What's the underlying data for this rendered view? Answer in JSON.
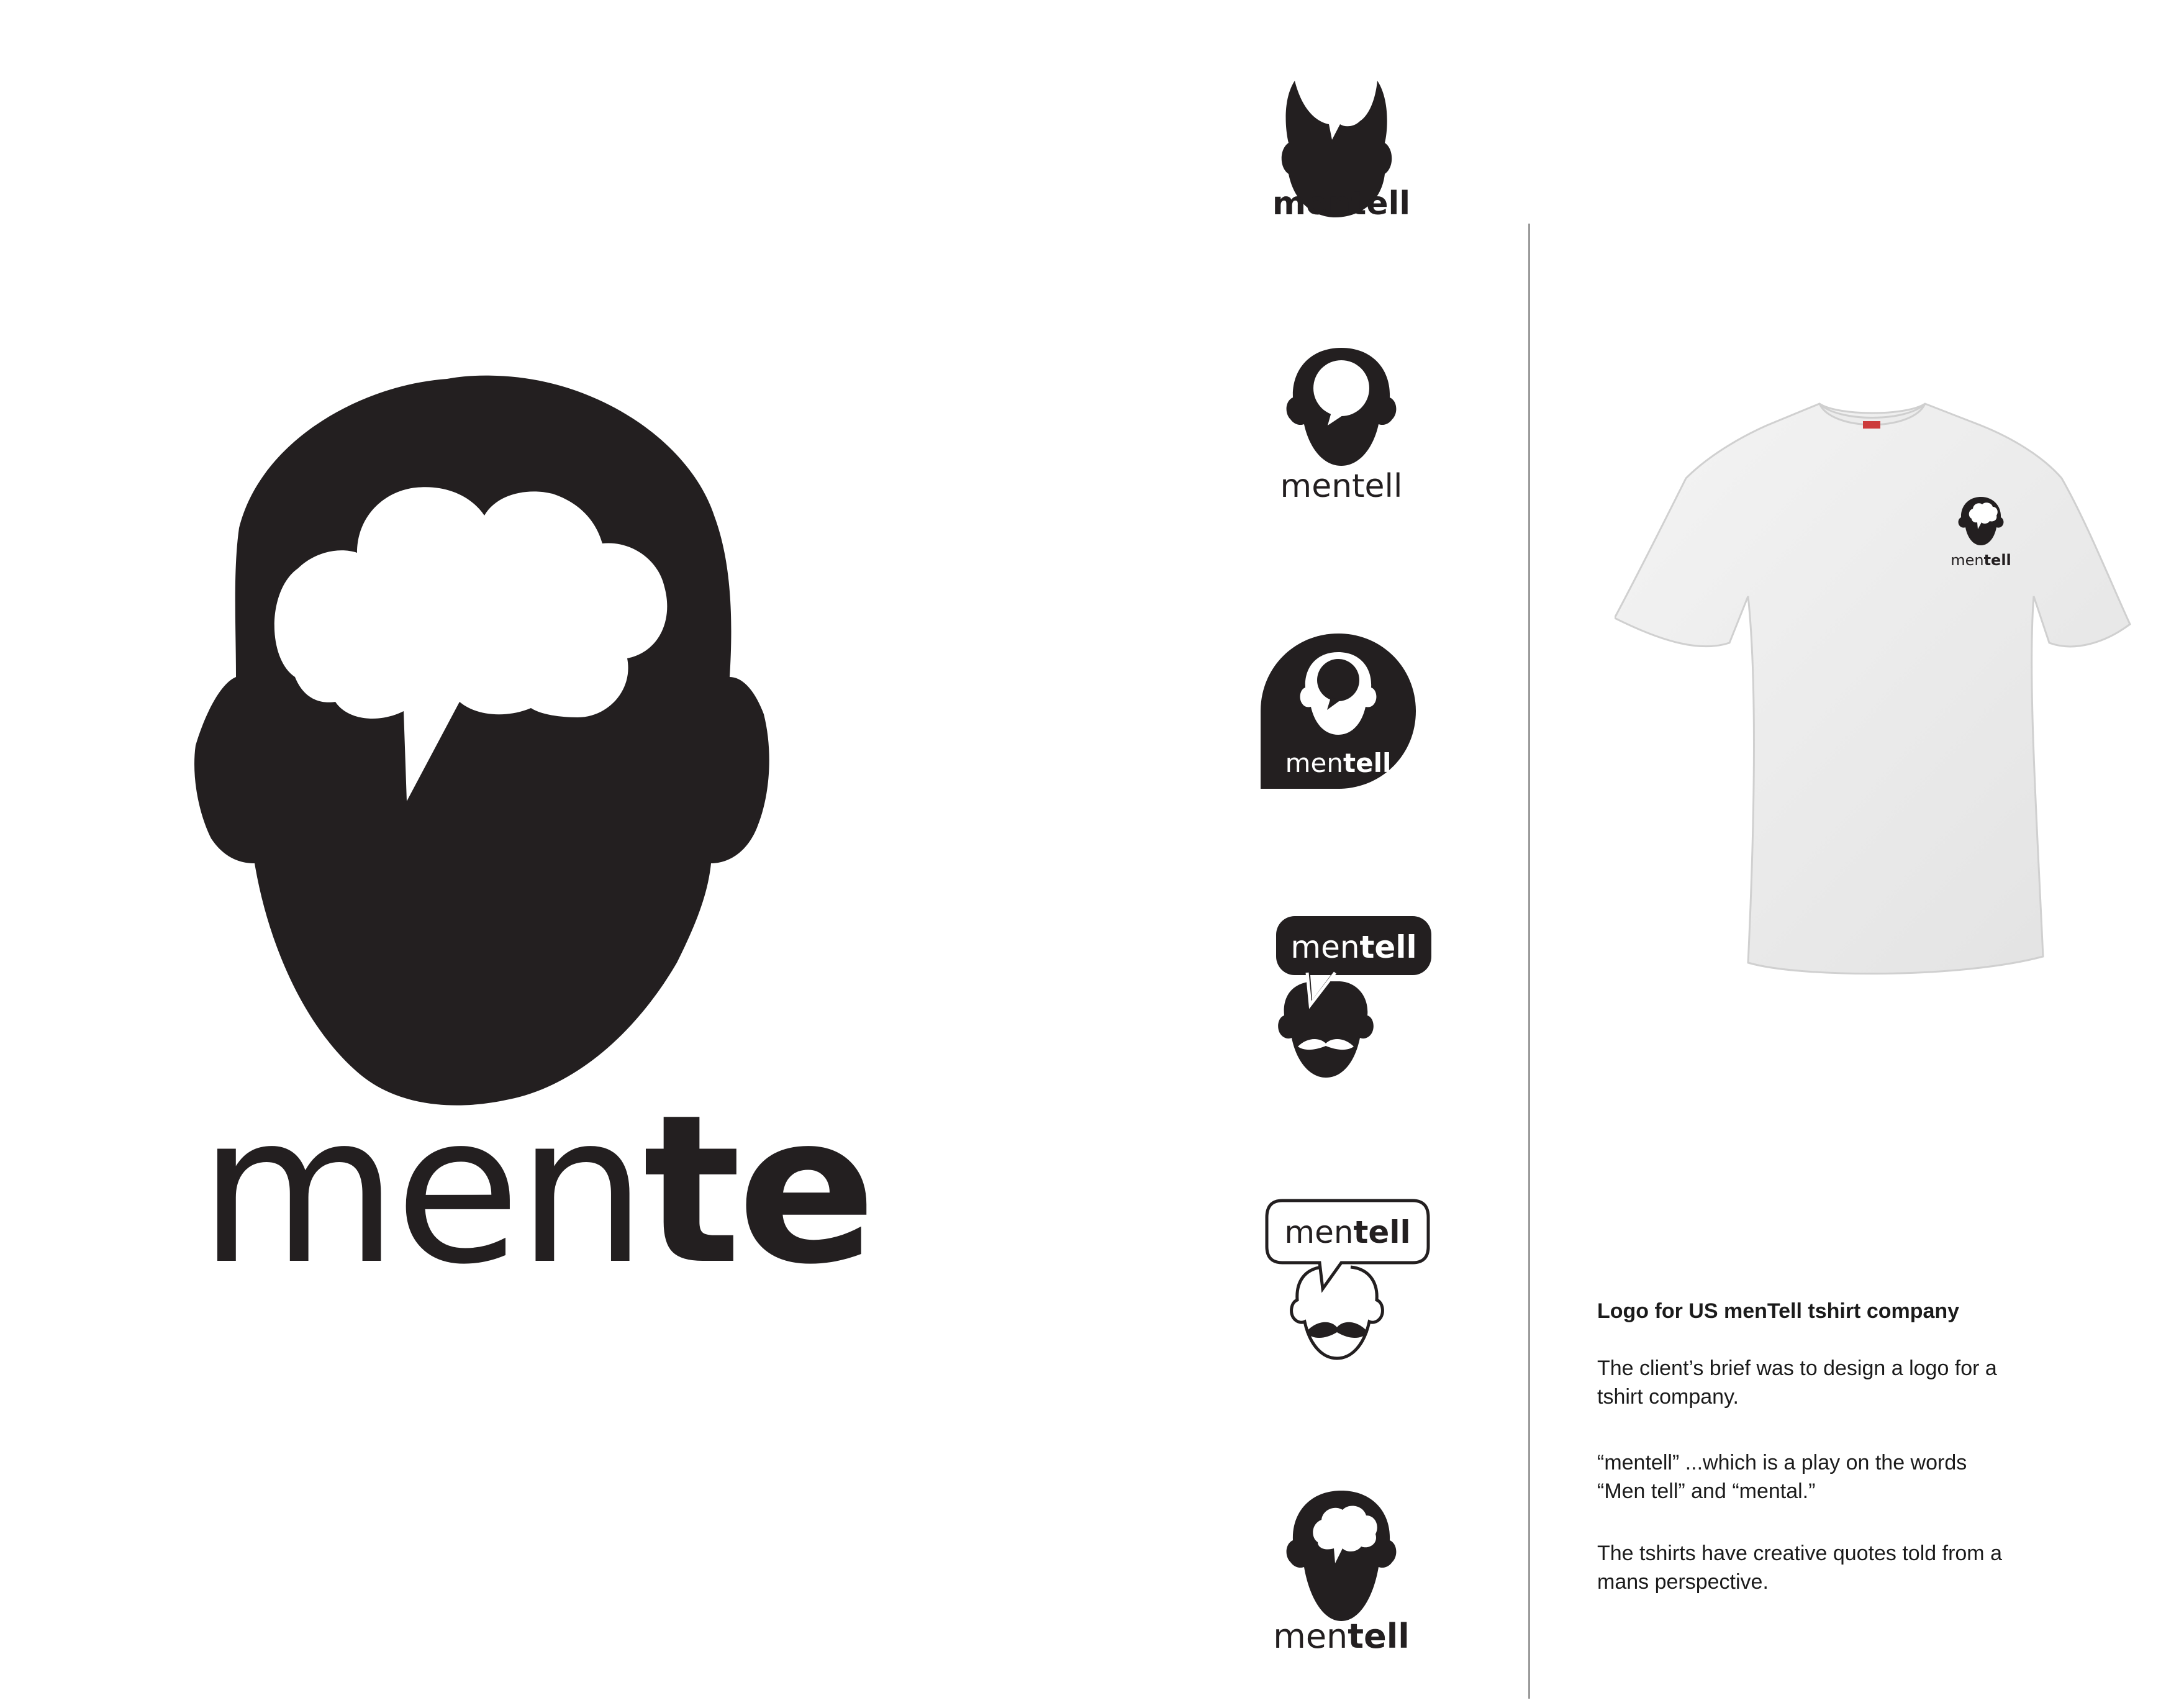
{
  "brand": {
    "wordmark_light": "men",
    "wordmark_bold": "tell",
    "wordmark_full": "mentell",
    "ink_color": "#231f20",
    "background_color": "#ffffff"
  },
  "variants": [
    {
      "style": "head with open-top bubble, bold wordmark",
      "wordmark": "mentell"
    },
    {
      "style": "head with round speech bubble, light wordmark",
      "wordmark": "mentell"
    },
    {
      "style": "teardrop badge, reversed wordmark",
      "wordmark_light": "men",
      "wordmark_bold": "tell"
    },
    {
      "style": "filled speech-bubble wordmark above moustached head",
      "wordmark_light": "men",
      "wordmark_bold": "tell"
    },
    {
      "style": "outlined speech-bubble wordmark above moustached head",
      "wordmark_light": "men",
      "wordmark_bold": "tell"
    },
    {
      "style": "head with cloud bubble, two-weight wordmark",
      "wordmark_light": "men",
      "wordmark_bold": "tell"
    }
  ],
  "mockup": {
    "item": "white t-shirt",
    "chest_print": {
      "wordmark_light": "men",
      "wordmark_bold": "tell"
    }
  },
  "description": {
    "title": "Logo for US menTell tshirt company",
    "paragraphs": [
      "The client’s brief was to design a logo for a tshirt company.",
      "“mentell” ...which is a play on the words “Men tell” and “mental.”",
      "The tshirts have creative quotes told from a mans perspective."
    ]
  }
}
